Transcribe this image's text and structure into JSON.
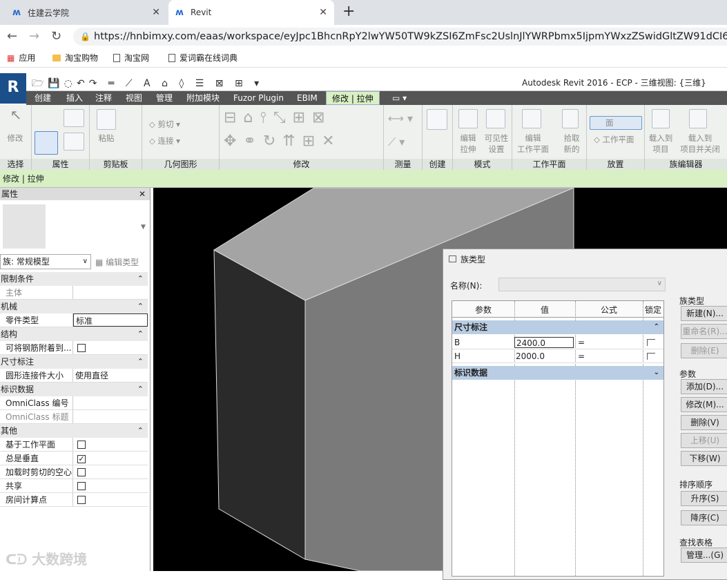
{
  "browser": {
    "tabs": [
      {
        "title": "住建云学院"
      },
      {
        "title": "Revit"
      }
    ],
    "url": "https://hnbimxy.com/eaas/workspace/eyJpc1BhcnRpY2lwYW50TW9kZSI6ZmFsc2UslnJlYWRPbmx5IjpmYWxzZSwidGltZW91dCI6MCwidXI",
    "bookmarks": [
      "应用",
      "淘宝购物",
      "淘宝网",
      "爱词霸在线词典"
    ]
  },
  "revit": {
    "title": "Autodesk Revit 2016 -      ECP - 三维视图: {三维}",
    "tabs": [
      "创建",
      "插入",
      "注释",
      "视图",
      "管理",
      "附加模块",
      "Fuzor Plugin",
      "EBIM",
      "修改 | 拉伸"
    ],
    "panels": [
      "选择",
      "属性",
      "剪贴板",
      "几何图形",
      "修改",
      "测量",
      "创建",
      "模式",
      "工作平面",
      "放置",
      "族编辑器"
    ],
    "ribbon_labels": {
      "modify": "修改",
      "paste": "粘贴",
      "cut": "剪切",
      "join": "连接",
      "edit_extrude": "编辑\n拉伸",
      "visibility": "可见性\n设置",
      "edit_wp": "编辑\n工作平面",
      "pick_new": "拾取\n新的",
      "face": "面",
      "wp": "工作平面",
      "load_project": "载入到\n项目",
      "load_close": "载入到\n项目并关闭"
    },
    "context": "修改 | 拉伸"
  },
  "properties": {
    "header": "属性",
    "family": "族: 常规模型",
    "edit_type": "编辑类型",
    "groups": [
      {
        "name": "限制条件",
        "rows": [
          {
            "k": "主体",
            "v": "",
            "dim": true
          }
        ]
      },
      {
        "name": "机械",
        "rows": [
          {
            "k": "零件类型",
            "v": "标准",
            "box": true
          }
        ]
      },
      {
        "name": "结构",
        "rows": [
          {
            "k": "可将钢筋附着到...",
            "cb": false
          }
        ]
      },
      {
        "name": "尺寸标注",
        "rows": [
          {
            "k": "圆形连接件大小",
            "v": "使用直径"
          }
        ]
      },
      {
        "name": "标识数据",
        "rows": [
          {
            "k": "OmniClass 编号",
            "v": ""
          },
          {
            "k": "OmniClass 标题",
            "v": "",
            "dim": true
          }
        ]
      },
      {
        "name": "其他",
        "rows": [
          {
            "k": "基于工作平面",
            "cb": false
          },
          {
            "k": "总是垂直",
            "cb": true
          },
          {
            "k": "加载时剪切的空心",
            "cb": false
          },
          {
            "k": "共享",
            "cb": false
          },
          {
            "k": "房间计算点",
            "cb": false
          }
        ]
      }
    ]
  },
  "dialog": {
    "title": "族类型",
    "name_label": "名称(N):",
    "columns": [
      "参数",
      "值",
      "公式",
      "锁定"
    ],
    "section1": "尺寸标注",
    "params": [
      {
        "name": "B",
        "value": "2400.0",
        "formula": "="
      },
      {
        "name": "H",
        "value": "2000.0",
        "formula": "="
      }
    ],
    "section2": "标识数据",
    "group_family_types": "族类型",
    "btn_new": "新建(N)...",
    "btn_rename": "重命名(R)...",
    "btn_delete_type": "删除(E)",
    "group_params": "参数",
    "btn_add": "添加(D)...",
    "btn_modify": "修改(M)...",
    "btn_delete": "删除(V)",
    "btn_up": "上移(U)",
    "btn_down": "下移(W)",
    "group_sort": "排序顺序",
    "btn_asc": "升序(S)",
    "btn_desc": "降序(C)",
    "group_lookup": "查找表格",
    "btn_manage": "管理...(G)"
  },
  "watermark": "大数跨境"
}
